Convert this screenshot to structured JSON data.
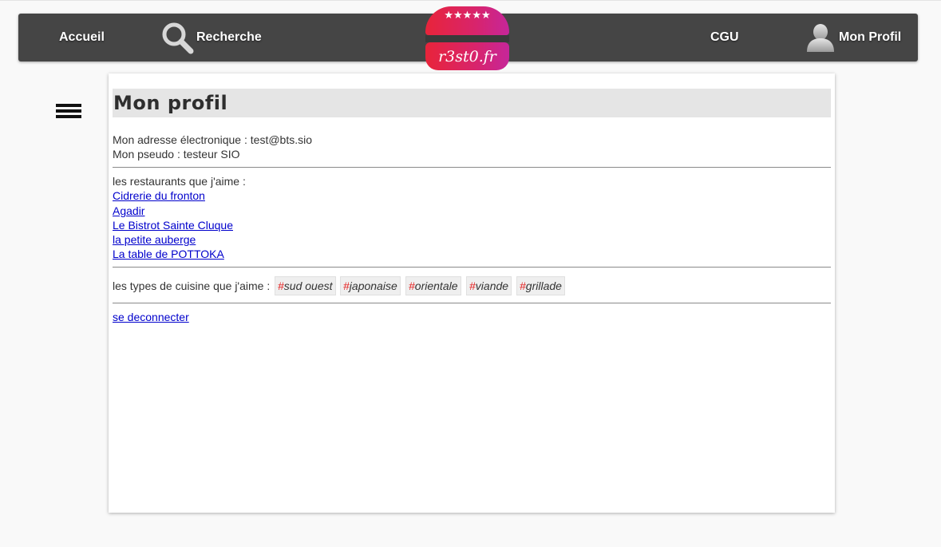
{
  "nav": {
    "home_label": "Accueil",
    "search_label": "Recherche",
    "cgu_label": "CGU",
    "profile_label": "Mon Profil"
  },
  "logo": {
    "stars": "★★★★★",
    "text": "r3st0.fr",
    "colors": {
      "primary": "#e8243a",
      "secondary": "#c6269a",
      "band": "#3a3a3a"
    }
  },
  "profile": {
    "title": "Mon profil",
    "email_line": "Mon adresse électronique : test@bts.sio",
    "pseudo_line": "Mon pseudo : testeur SIO",
    "restaurants_heading": "les restaurants que j'aime :",
    "restaurants": [
      "Cidrerie du fronton",
      "Agadir",
      "Le Bistrot Sainte Cluque",
      "la petite auberge",
      "La table de POTTOKA"
    ],
    "cuisine_heading": "les types de cuisine que j'aime :",
    "cuisine_tags": [
      {
        "hash": "#",
        "label": "sud ouest"
      },
      {
        "hash": "#",
        "label": "japonaise"
      },
      {
        "hash": "#",
        "label": "orientale"
      },
      {
        "hash": "#",
        "label": "viande"
      },
      {
        "hash": "#",
        "label": "grillade"
      }
    ],
    "logout_label": "se deconnecter"
  },
  "colors": {
    "navbar": "#454545",
    "link": "#0000cc",
    "tag_hash": "#e52222",
    "title_bg": "#e5e5e5"
  },
  "icons": {
    "search": "search-icon",
    "user": "user-icon",
    "menu": "hamburger-menu-icon"
  }
}
